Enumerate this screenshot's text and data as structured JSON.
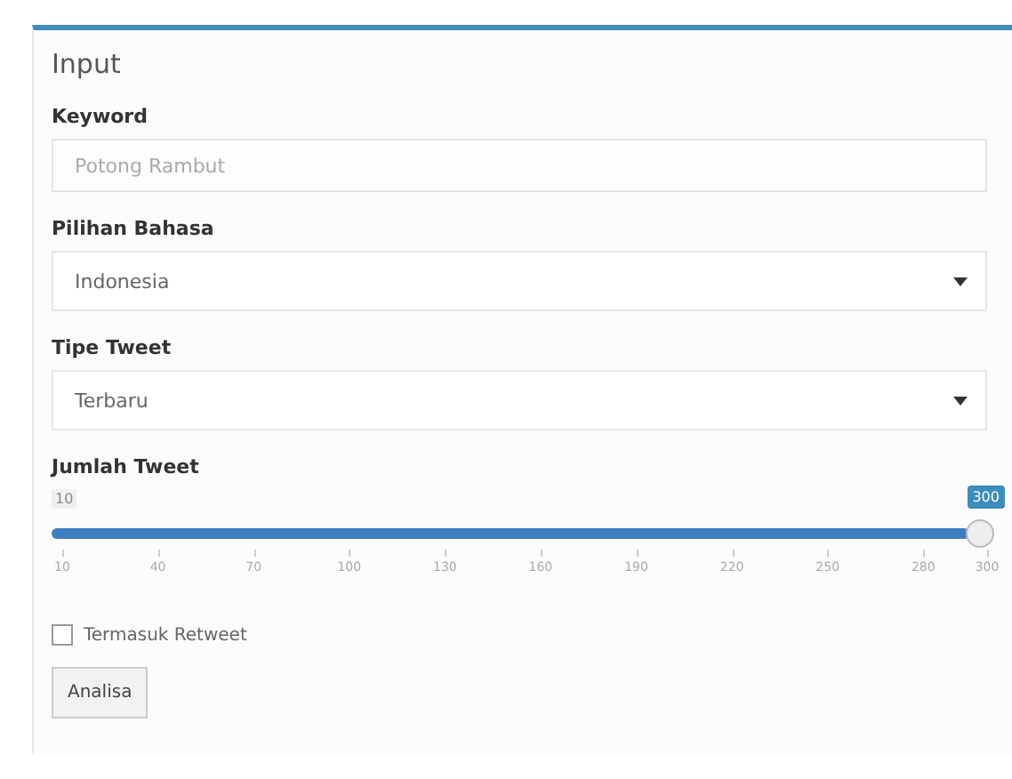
{
  "panel": {
    "title": "Input"
  },
  "keyword": {
    "label": "Keyword",
    "placeholder": "Potong Rambut"
  },
  "language": {
    "label": "Pilihan Bahasa",
    "value": "Indonesia"
  },
  "tweet_type": {
    "label": "Tipe Tweet",
    "value": "Terbaru"
  },
  "tweet_count": {
    "label": "Jumlah Tweet",
    "min_label": "10",
    "value_label": "300",
    "level": 1,
    "ticks": [
      "10",
      "40",
      "70",
      "100",
      "130",
      "160",
      "190",
      "220",
      "250",
      "280",
      "300"
    ]
  },
  "retweet": {
    "label": "Termasuk Retweet",
    "checked": false
  },
  "button": "Analisa"
}
